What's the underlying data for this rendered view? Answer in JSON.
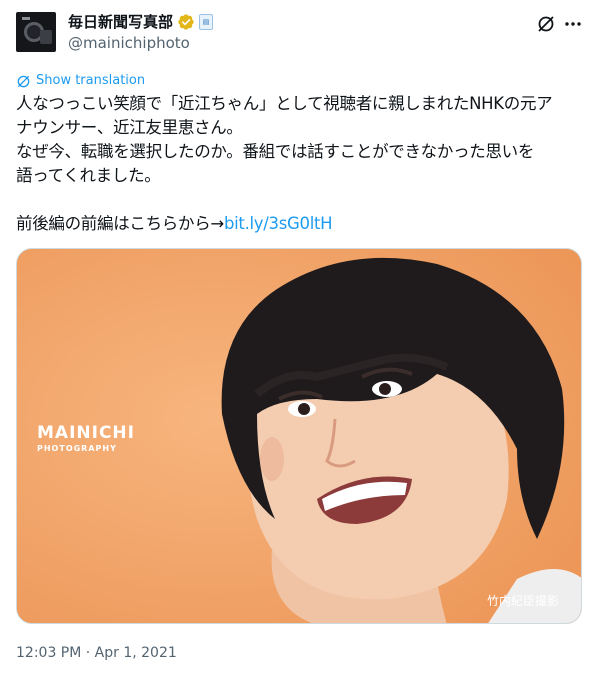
{
  "account": {
    "display_name": "毎日新聞写真部",
    "handle": "@mainichiphoto"
  },
  "translate": {
    "label": "Show translation"
  },
  "tweet": {
    "lines": [
      "人なつっこい笑顔で「近江ちゃん」として視聴者に親しまれたNHKの元ア",
      "ナウンサー、近江友里恵さん。",
      "なぜ今、転職を選択したのか。番組では話すことができなかった思いを",
      "語ってくれました。"
    ],
    "link_prefix": "前後編の前編はこちらから→",
    "link_text": "bit.ly/3sG0ltH"
  },
  "media": {
    "watermark_main": "MAINICHI",
    "watermark_sub": "PHOTOGRAPHY",
    "credit": "竹内紀臣撮影"
  },
  "timestamp": "12:03 PM · Apr 1, 2021",
  "icons": {
    "verified": "verified-badge-icon",
    "affiliate": "affiliate-badge-icon",
    "grok": "grok-icon",
    "more": "more-options-icon",
    "translate": "translate-icon"
  },
  "colors": {
    "accent": "#1d9bf0",
    "verified": "#e2b719",
    "secondary_text": "#536471",
    "photo_background": "#f2a46a"
  }
}
